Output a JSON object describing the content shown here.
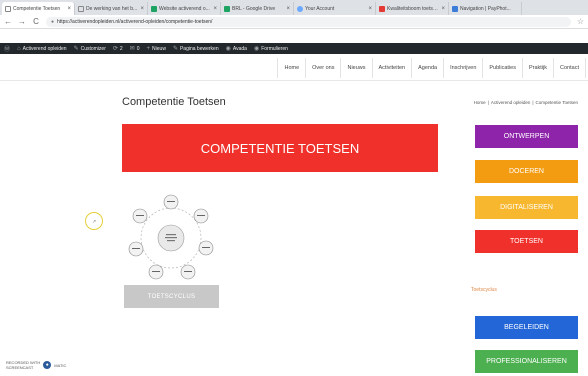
{
  "browser": {
    "tabs": [
      {
        "title": "Competentie Toetsen",
        "favicon_color": "#ffffff",
        "active": true
      },
      {
        "title": "De werking van het b...",
        "favicon_color": "#ffffff",
        "active": false
      },
      {
        "title": "Website activerend o...",
        "favicon_color": "#1da463",
        "active": false
      },
      {
        "title": "BRL - Google Drive",
        "favicon_color": "#1da463",
        "active": false
      },
      {
        "title": "Your Account",
        "favicon_color": "#6aa9ff",
        "active": false
      },
      {
        "title": "Kwaliteitsboom toetse...",
        "favicon_color": "#e53935",
        "active": false
      },
      {
        "title": "Navigation | PayPhot...",
        "favicon_color": "#3b7dd8",
        "active": false
      }
    ],
    "tab_close": "×",
    "back": "←",
    "forward": "→",
    "reload": "C",
    "lock": "🔒",
    "url": "https://activerendopleiden.nl/activerend-opleiden/competentie-toetsen/",
    "star": "☆"
  },
  "adminbar": {
    "items": [
      {
        "icon": "Ⓦ",
        "label": ""
      },
      {
        "icon": "⌂",
        "label": "Activerend opleiden"
      },
      {
        "icon": "✎",
        "label": "Customizer"
      },
      {
        "icon": "⟳",
        "label": "2"
      },
      {
        "icon": "✉",
        "label": "0"
      },
      {
        "icon": "+",
        "label": "Nieuw"
      },
      {
        "icon": "✎",
        "label": "Pagina bewerken"
      },
      {
        "icon": "◉",
        "label": "Avada"
      },
      {
        "icon": "◉",
        "label": "Formulieren"
      }
    ]
  },
  "sitenav": {
    "items": [
      "Home",
      "Over ons",
      "Nieuws",
      "Activiteiten",
      "Agenda",
      "Inschrijven",
      "Publicaties",
      "Praktijk",
      "Contact"
    ]
  },
  "page": {
    "title": "Competentie Toetsen",
    "breadcrumb": [
      "Home",
      "|",
      "Activerend opleiden",
      "|",
      "Competentie Toetsen"
    ],
    "banner": "COMPETENTIE TOETSEN",
    "cycle_button": "TOETSCYCLUS"
  },
  "sidebar": {
    "buttons": [
      {
        "label": "ONTWERPEN",
        "color": "#8e24aa"
      },
      {
        "label": "DOCEREN",
        "color": "#f39c12"
      },
      {
        "label": "DIGITALISEREN",
        "color": "#f7b72e"
      },
      {
        "label": "TOETSEN",
        "color": "#f0302b"
      },
      {
        "label": "BEGELEIDEN",
        "color": "#2266d8"
      },
      {
        "label": "PROFESSIONALISEREN",
        "color": "#4caf50"
      }
    ],
    "link": "Toetscyclus"
  },
  "watermark": {
    "line1": "RECORDED WITH",
    "line2": "SCREENCAST",
    "line3": "MATIC"
  }
}
